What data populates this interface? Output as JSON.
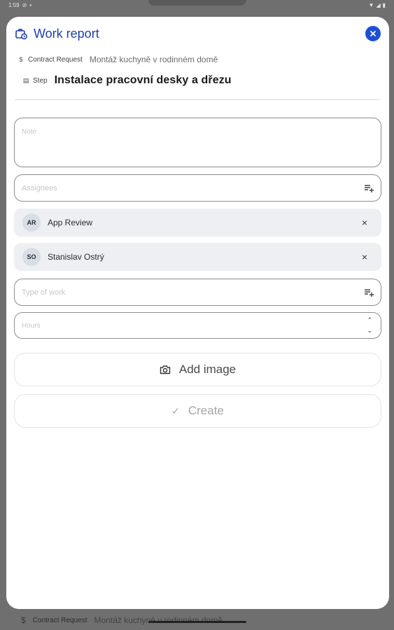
{
  "statusbar": {
    "time": "1:59"
  },
  "modal": {
    "title": "Work report",
    "contract_label": "Contract Request",
    "contract_value": "Montáž kuchyně v rodinném domě",
    "step_label": "Step",
    "step_value": "Instalace pracovní desky a dřezu"
  },
  "form": {
    "note_placeholder": "Note",
    "assignees_placeholder": "Assignees",
    "assignees": [
      {
        "initials": "AR",
        "name": "App Review"
      },
      {
        "initials": "SO",
        "name": "Stanislav Ostrý"
      }
    ],
    "type_of_work_placeholder": "Type of work",
    "hours_placeholder": "Hours"
  },
  "actions": {
    "add_image_label": "Add image",
    "create_label": "Create"
  },
  "background": {
    "contract_label": "Contract Request",
    "contract_value": "Montáž kuchyně v rodinném domě"
  },
  "colors": {
    "accent": "#1d4fd6",
    "title": "#1f3fa8"
  }
}
